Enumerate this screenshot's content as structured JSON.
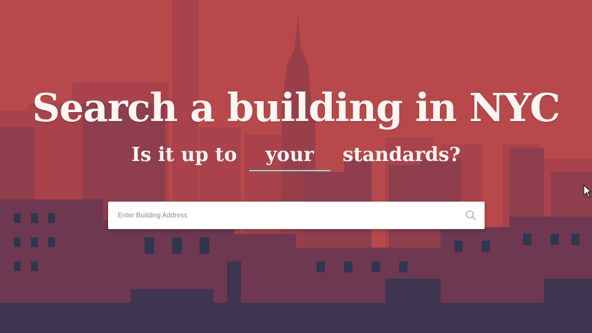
{
  "hero": {
    "title": "Search a building in NYC",
    "subtitle_before": "Is it up to",
    "subtitle_blank": "your",
    "subtitle_after": "standards?"
  },
  "search": {
    "placeholder": "Enter Building Address",
    "value": "",
    "icon": "search-icon"
  },
  "colors": {
    "overlay": "#b8494b",
    "shadow": "#253047",
    "text": "#fbf6f2",
    "underline_accent": "#8fd3cf"
  }
}
